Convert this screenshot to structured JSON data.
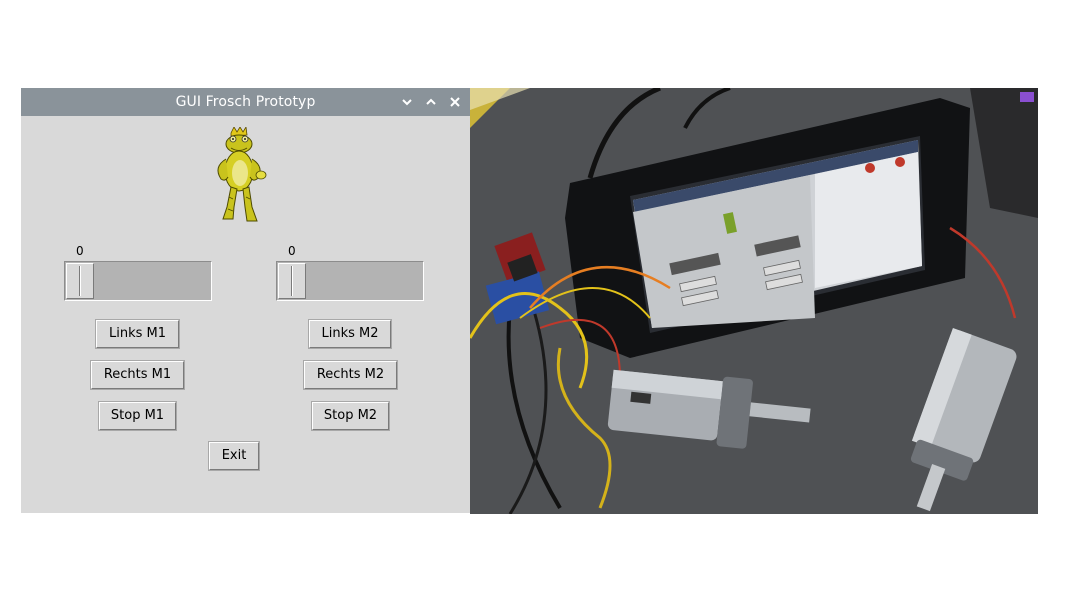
{
  "window": {
    "title": "GUI Frosch Prototyp",
    "controls": [
      "chevron-down-icon",
      "chevron-up-icon",
      "close-icon"
    ],
    "titlebar_color": "#8a939a",
    "background_color": "#d9d9d9"
  },
  "motor1": {
    "scale_value": "0",
    "left_label": "Links M1",
    "right_label": "Rechts M1",
    "stop_label": "Stop M1"
  },
  "motor2": {
    "scale_value": "0",
    "left_label": "Links M2",
    "right_label": "Rechts M2",
    "stop_label": "Stop M2"
  },
  "exit_label": "Exit"
}
